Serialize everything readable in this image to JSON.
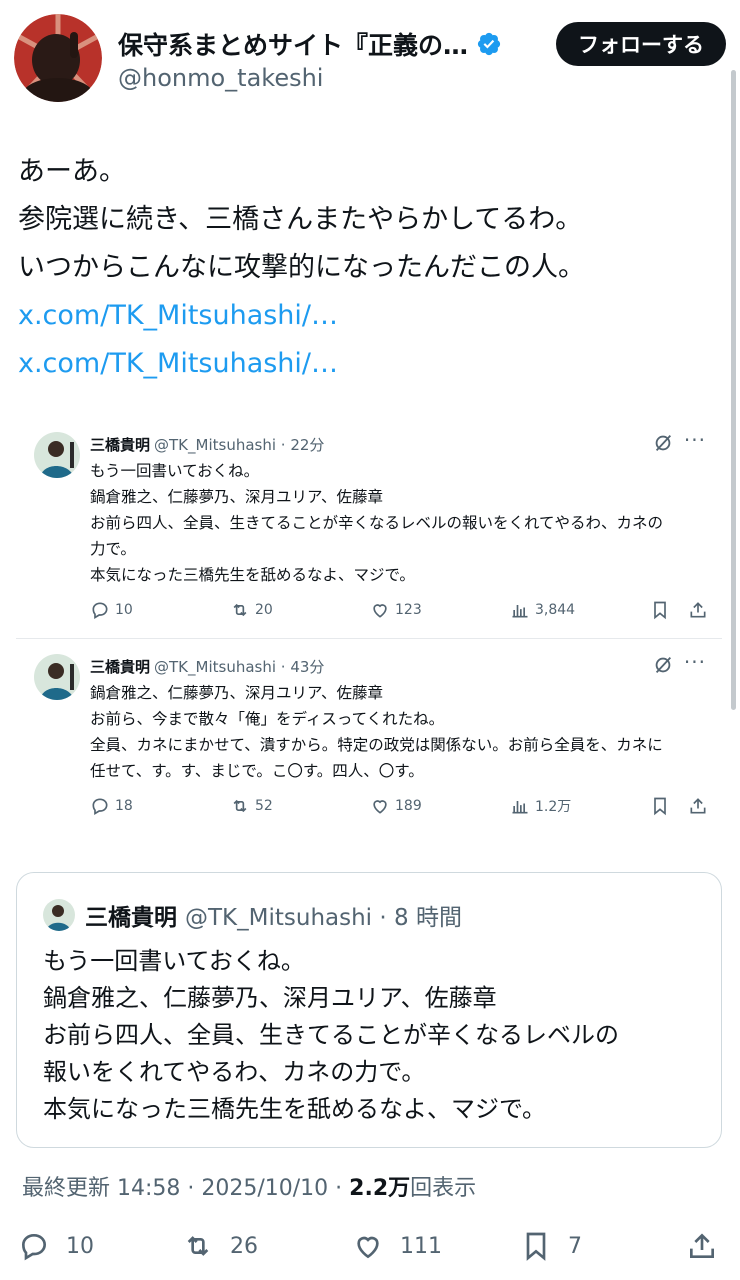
{
  "author": {
    "display_name": "保守系まとめサイト『正義の…",
    "handle": "@honmo_takeshi",
    "avatar_icon": "avatar-silhouette-icon",
    "verified_icon": "verified-badge-icon",
    "verified_color": "#1d9bf0"
  },
  "follow_button": {
    "label": "フォローする"
  },
  "post": {
    "lines": [
      "あーあ。",
      "参院選に続き、三橋さんまたやらかしてるわ。",
      "いつからこんなに攻撃的になったんだこの人。"
    ],
    "links": [
      "x.com/TK_Mitsuhashi/…",
      "x.com/TK_Mitsuhashi/…"
    ],
    "link_color": "#1d9bf0"
  },
  "embeds": [
    {
      "name": "三橋貴明",
      "handle_time": "@TK_Mitsuhashi · 22分",
      "lines": [
        "もう一回書いておくね。",
        "鍋倉雅之、仁藤夢乃、深月ユリア、佐藤章",
        "お前ら四人、全員、生きてることが辛くなるレベルの報いをくれてやるわ、カネの",
        "力で。",
        "本気になった三橋先生を舐めるなよ、マジで。"
      ],
      "replies": "10",
      "reposts": "20",
      "likes": "123",
      "views": "3,844"
    },
    {
      "name": "三橋貴明",
      "handle_time": "@TK_Mitsuhashi · 43分",
      "lines": [
        "鍋倉雅之、仁藤夢乃、深月ユリア、佐藤章",
        "お前ら、今まで散々「俺」をディスってくれたね。",
        "全員、カネにまかせて、潰すから。特定の政党は関係ない。お前ら全員を、カネに",
        "任せて、す。す、まじで。こ〇す。四人、〇す。"
      ],
      "replies": "18",
      "reposts": "52",
      "likes": "189",
      "views": "1.2万"
    }
  ],
  "quote": {
    "name": "三橋貴明",
    "handle_time": "@TK_Mitsuhashi · 8 時間",
    "lines": [
      "もう一回書いておくね。",
      "鍋倉雅之、仁藤夢乃、深月ユリア、佐藤章",
      "お前ら四人、全員、生きてることが辛くなるレベルの",
      "報いをくれてやるわ、カネの力で。",
      "本気になった三橋先生を舐めるなよ、マジで。"
    ]
  },
  "meta": {
    "prefix": "最終更新 14:58 · 2025/10/10 ·",
    "views_count": "2.2万",
    "views_label": "回表示"
  },
  "actions": {
    "replies": "10",
    "reposts": "26",
    "likes": "111",
    "bookmarks": "7"
  },
  "colors": {
    "text": "#0f1419",
    "secondary": "#536471",
    "border": "#cfd9de"
  }
}
